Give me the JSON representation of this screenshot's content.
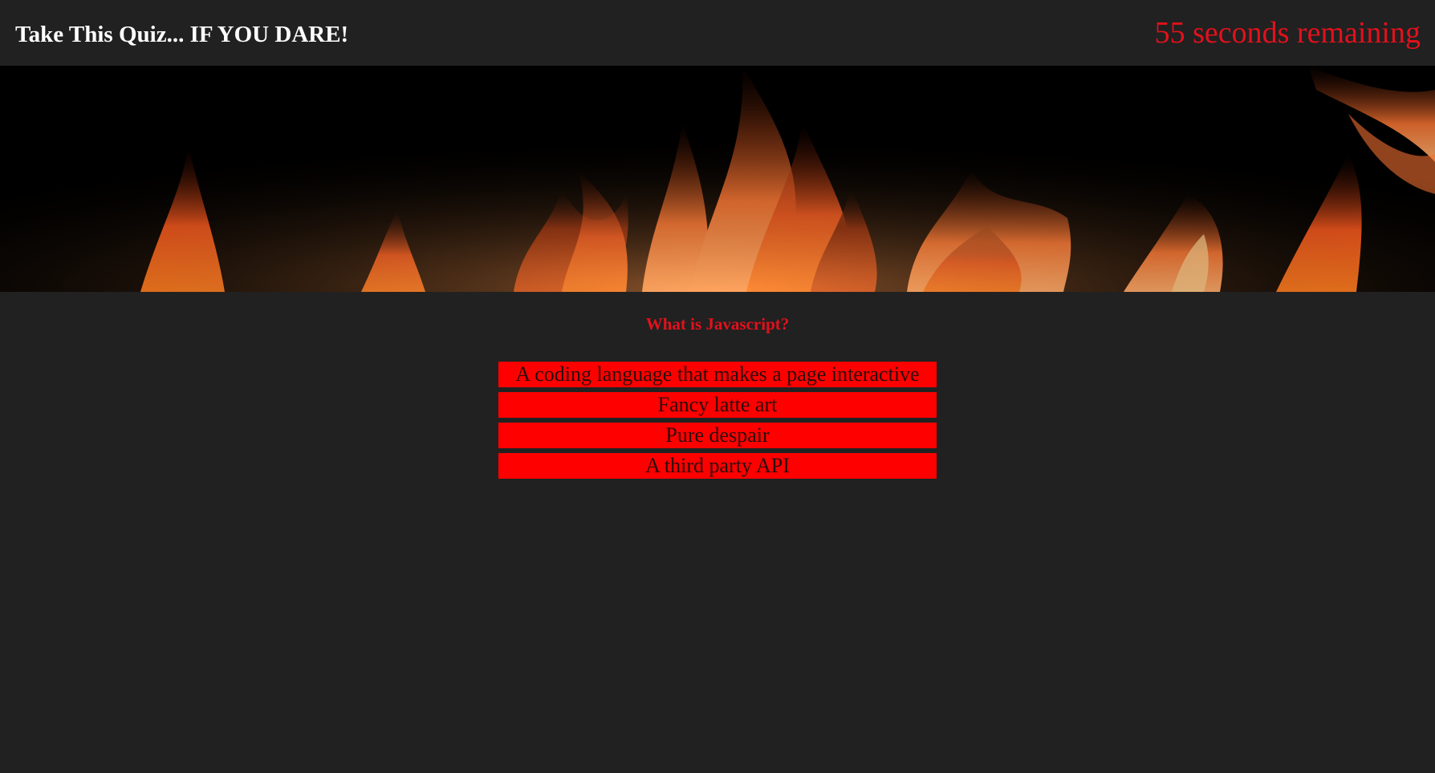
{
  "header": {
    "title": "Take This Quiz... IF YOU DARE!",
    "timer_text": "55 seconds remaining"
  },
  "banner": {
    "image": "flames-banner"
  },
  "quiz": {
    "question": "What is Javascript?",
    "answers": [
      "A coding language that makes a page interactive",
      "Fancy latte art",
      "Pure despair",
      "A third party API"
    ]
  },
  "colors": {
    "background": "#212121",
    "accent_red": "#e2111c",
    "answer_bg": "#ff0000",
    "title_text": "#ffffff"
  }
}
